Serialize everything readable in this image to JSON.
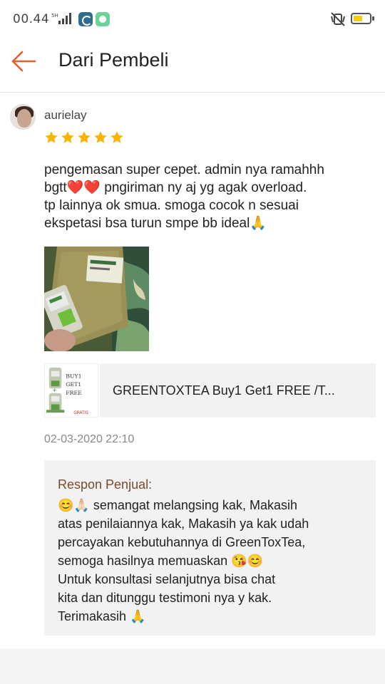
{
  "status_bar": {
    "time": "00.44",
    "icons": [
      "signal-icon",
      "app-icon",
      "app-icon",
      "mute-icon",
      "battery-icon"
    ]
  },
  "header": {
    "title": "Dari Pembeli",
    "back_icon": "back-arrow-icon",
    "accent_color": "#e0602b"
  },
  "review": {
    "username": "aurielay",
    "rating": 5,
    "max_rating": 5,
    "star_color": "#f7b500",
    "text": "pengemasan super cepet. admin nya ramahhh\nbgtt❤️❤️ pngiriman ny aj yg agak overload.\ntp lainnya ok smua. smoga cocok n sesuai\nekspetasi bsa turun smpe bb ideal🙏",
    "photo_icon": "review-photo"
  },
  "product": {
    "name": "GREENTOXTEA Buy1 Get1 FREE  /T...",
    "thumb_text": [
      "BUY1",
      "GET1",
      "FREE",
      "GRATIS"
    ]
  },
  "date": "02-03-2020 22:10",
  "seller_response": {
    "label": "Respon Penjual:",
    "text": "😊🙏🏻 semangat melangsing kak, Makasih\natas penilaiannya kak, Makasih ya kak udah\npercayakan kebutuhannya di GreenToxTea,\nsemoga hasilnya memuaskan 😘😊\nUntuk konsultasi selanjutnya bisa chat\nkita dan ditunggu testimoni nya y kak.\nTerimakasih 🙏"
  }
}
